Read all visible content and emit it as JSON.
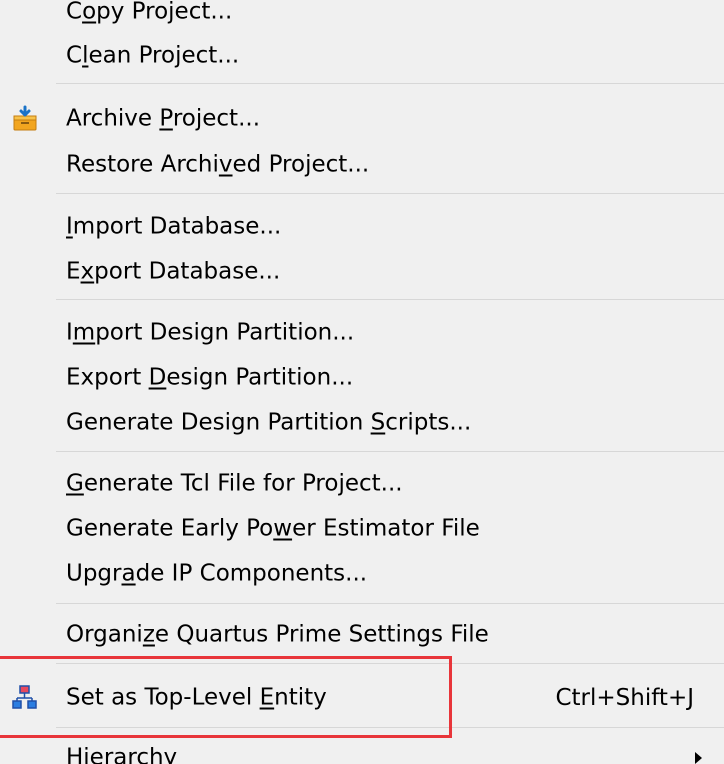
{
  "menu": {
    "items": [
      {
        "id": "copy_project",
        "pre": "C",
        "u": "o",
        "post": "py Project..."
      },
      {
        "id": "clean_project",
        "pre": "C",
        "u": "l",
        "post": "ean Project..."
      },
      {
        "id": "archive_project",
        "pre": "Archive ",
        "u": "P",
        "post": "roject..."
      },
      {
        "id": "restore_archived_project",
        "pre": "Restore Archi",
        "u": "v",
        "post": "ed Project..."
      },
      {
        "id": "import_database",
        "pre": "",
        "u": "I",
        "post": "mport Database..."
      },
      {
        "id": "export_database",
        "pre": "E",
        "u": "x",
        "post": "port Database..."
      },
      {
        "id": "import_design_partition",
        "pre": "I",
        "u": "m",
        "post": "port Design Partition..."
      },
      {
        "id": "export_design_partition",
        "pre": "Export ",
        "u": "D",
        "post": "esign Partition..."
      },
      {
        "id": "generate_design_partition_scripts",
        "pre": "Generate Design Partition ",
        "u": "S",
        "post": "cripts..."
      },
      {
        "id": "generate_tcl_file",
        "pre": "",
        "u": "G",
        "post": "enerate Tcl File for Project..."
      },
      {
        "id": "generate_early_power_estimator_file",
        "pre": "Generate Early Po",
        "u": "w",
        "post": "er Estimator File"
      },
      {
        "id": "upgrade_ip_components",
        "pre": "Upgr",
        "u": "a",
        "post": "de IP Components..."
      },
      {
        "id": "organize_settings_file",
        "pre": "Organi",
        "u": "z",
        "post": "e Quartus Prime Settings File"
      },
      {
        "id": "set_top_level_entity",
        "pre": "Set as Top-Level ",
        "u": "E",
        "post": "ntity",
        "shortcut": "Ctrl+Shift+J"
      },
      {
        "id": "hierarchy",
        "pre": "Hierarchy",
        "u": "",
        "post": ""
      }
    ]
  },
  "icons": {
    "archive": "archive-box-icon",
    "entity": "hierarchy-entity-icon",
    "submenu": "submenu-arrow-icon"
  },
  "colors": {
    "highlight_border": "#e8353a",
    "menu_bg": "#f0f0f0",
    "separator": "#d7d7d7"
  }
}
